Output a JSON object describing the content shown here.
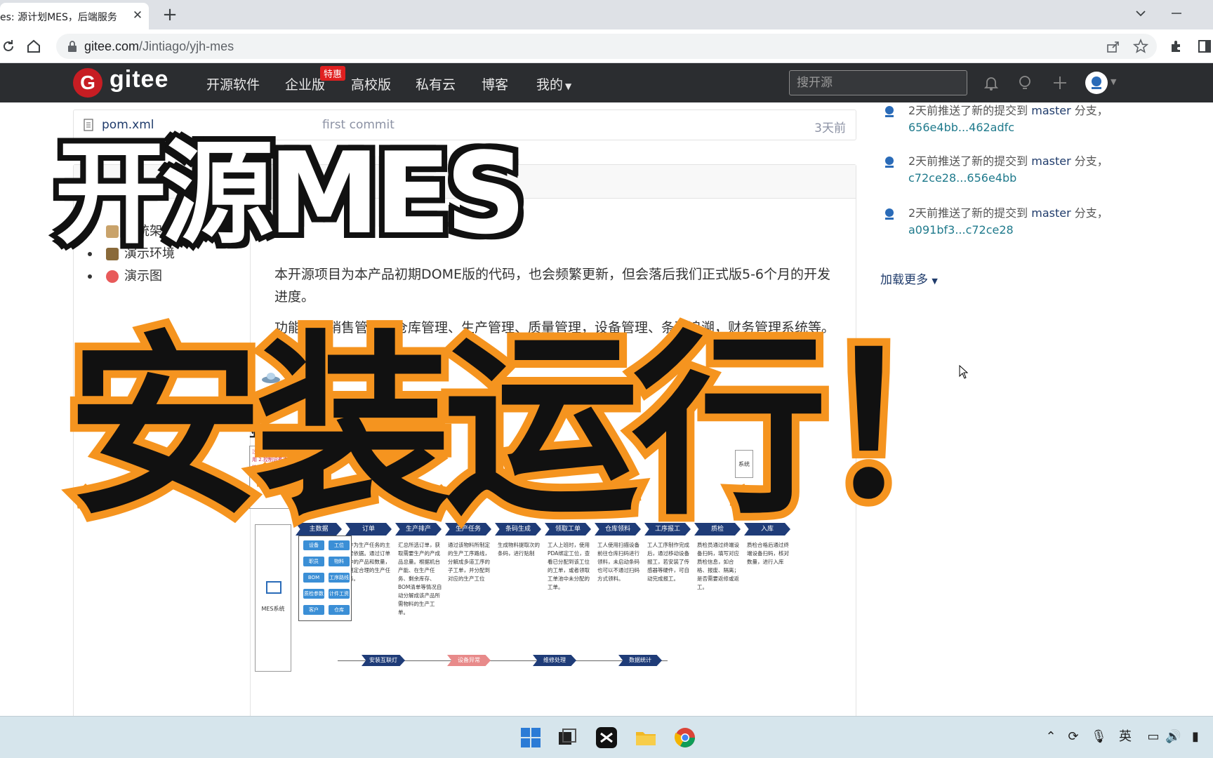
{
  "browser": {
    "tab_title": "es: 源计划MES，后端服务",
    "url_host": "gitee.com",
    "url_path": "/Jintiago/yjh-mes"
  },
  "gitee_nav": {
    "logo_text": "gitee",
    "items": [
      "开源软件",
      "企业版",
      "高校版",
      "私有云",
      "博客",
      "我的"
    ],
    "special_badge": "特惠",
    "search_placeholder": "搜开源"
  },
  "file_row": {
    "name": "pom.xml",
    "commit_msg": "first commit",
    "time": "3天前"
  },
  "toc": {
    "items": [
      {
        "label": "系统架构",
        "emoji": "diagram-icon"
      },
      {
        "label": "演示环境",
        "emoji": "portrait-icon"
      },
      {
        "label": "演示图",
        "emoji": "target-icon"
      }
    ]
  },
  "readme": {
    "paragraph1": "本开源项目为本产品初期DOME版的代码，也会频繁更新，但会落后我们正式版5-6个月的开发进度。",
    "paragraph2": "功能包括销售管理、仓库管理、生产管理、质量管理，设备管理、条码追溯，财务管理系统等。",
    "section_heading": "业务"
  },
  "diagram": {
    "note": "注：1.支持集 … 用 2.控制设备支持 手机、PDA、工业 手机、PC",
    "right_chip": "系统",
    "mes_label": "MES系统",
    "stages": [
      {
        "label": "主数据",
        "desc": ""
      },
      {
        "label": "订单",
        "desc": "作为生产任务的主要依据。通过订单中的产品和数量，制定合理的生产任务。"
      },
      {
        "label": "生产排产",
        "desc": "汇总所选订单，获取需要生产的产成品总量。根据机台产能、在生产任务、剩余库存、BOM清单等情况自动分解成该产品所需物料的生产工单。"
      },
      {
        "label": "生产任务",
        "desc": "通过该物料所制定的生产工序路线，分解成多道工序的子工单，并分配到对应的生产工位"
      },
      {
        "label": "条码生成",
        "desc": "生成物料提取次的条码，进行贴制"
      },
      {
        "label": "领取工单",
        "desc": "工人上班时，使用PDA绑定工位，查看已分配到该工位的工单，或者领取工单池中未分配的工单。"
      },
      {
        "label": "仓库领料",
        "desc": "工人使用扫描设备前往仓库扫码进行领料，未启动条码也可以不通过扫码方式领料。"
      },
      {
        "label": "工序报工",
        "desc": "工人工序制作完成后，通过移动设备报工，若安装了传感器等硬件，可自动完成报工。"
      },
      {
        "label": "质检",
        "desc": "质检员通过终端设备扫码，填写对应质检信息，如合格、报废、隔离；是否需要返修或返工。"
      },
      {
        "label": "入库",
        "desc": "质检合格后通过终端设备扫码，核对数量，进行入库"
      }
    ],
    "modules": [
      "设备",
      "工位",
      "职员",
      "物料",
      "BOM",
      "工序路线",
      "质检参数",
      "计件工资",
      "客户",
      "仓库"
    ],
    "bottom_stages": [
      {
        "label": "安装互联灯",
        "color": "#1f3c78"
      },
      {
        "label": "设备异常",
        "color": "#e88a8a"
      },
      {
        "label": "维修处理",
        "color": "#1f3c78"
      },
      {
        "label": "数据统计",
        "color": "#1f3c78"
      }
    ]
  },
  "activity": [
    {
      "text": "2天前推送了新的提交到",
      "branch": "master",
      "suffix": "分支，",
      "hash": "656e4bb...462adfc"
    },
    {
      "text": "2天前推送了新的提交到",
      "branch": "master",
      "suffix": "分支，",
      "hash": "c72ce28...656e4bb"
    },
    {
      "text": "2天前推送了新的提交到",
      "branch": "master",
      "suffix": "分支，",
      "hash": "a091bf3...c72ce28"
    }
  ],
  "load_more": "加载更多",
  "overlay": {
    "title_top": "开源MES",
    "title_bottom": "安装运行！"
  },
  "taskbar": {
    "apps": [
      "windows-start-icon",
      "task-view-icon",
      "capcut-icon",
      "file-explorer-icon",
      "chrome-icon"
    ],
    "ime_label": "英"
  },
  "colors": {
    "gitee_red": "#c71d23",
    "nav_bg": "#2b2d30",
    "overlay_orange": "#f5941f"
  }
}
